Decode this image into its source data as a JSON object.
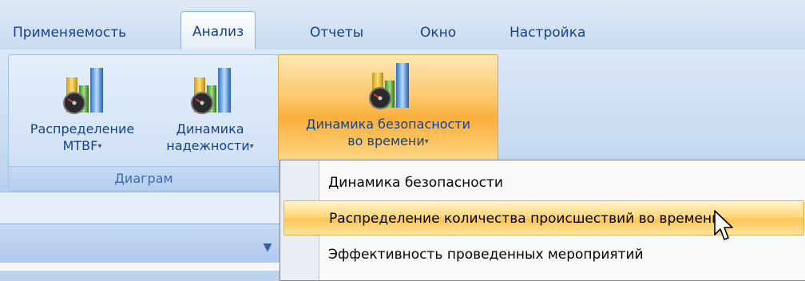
{
  "tabs": [
    {
      "label": "Применяемость",
      "active": false
    },
    {
      "label": "Анализ",
      "active": true
    },
    {
      "label": "Отчеты",
      "active": false
    },
    {
      "label": "Окно",
      "active": false
    },
    {
      "label": "Настройка",
      "active": false
    }
  ],
  "ribbon": {
    "group_label": "Диаграм",
    "buttons": [
      {
        "line1": "Распределение",
        "line2": "MTBF",
        "icon": "chart-gauge-icon"
      },
      {
        "line1": "Динамика",
        "line2": "надежности",
        "icon": "chart-gauge-icon"
      },
      {
        "line1": "Динамика безопасности",
        "line2": "во времени",
        "icon": "chart-gauge-icon",
        "highlighted": true
      }
    ],
    "dropdown_arrow": "▾"
  },
  "menu": {
    "items": [
      {
        "label": "Динамика безопасности"
      },
      {
        "label": "Распределение количества происшествий во времени",
        "hovered": true
      },
      {
        "label": "Эффективность проведенных мероприятий"
      }
    ]
  },
  "pane": {
    "collapse_arrow": "▼"
  },
  "colors": {
    "ribbon_bg": "#c9dcf2",
    "highlight_orange": "#fbae3a",
    "menu_hover": "#ffd97a",
    "text_blue": "#15428b"
  }
}
